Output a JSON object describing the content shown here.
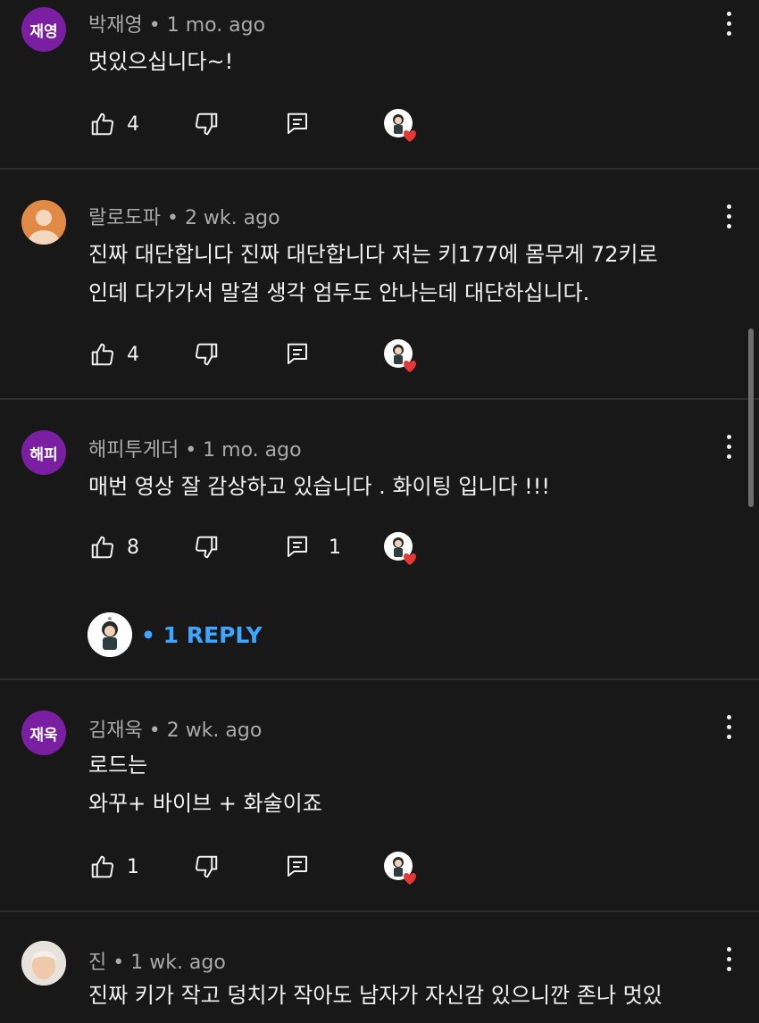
{
  "colors": {
    "background": "#181818",
    "text": "#f1f1f1",
    "meta": "#aaaaaa",
    "link": "#3ea6ff",
    "avatar_purple": "#7b1fa2",
    "heart": "#e53935"
  },
  "comments": [
    {
      "avatar_text": "재영",
      "author": "박재영",
      "time": "1 mo. ago",
      "lines": [
        "멋있으십니다~!"
      ],
      "likes": "4",
      "replies_count": ""
    },
    {
      "avatar_text": "",
      "author": "랄로도파",
      "time": "2 wk. ago",
      "lines": [
        "진짜 대단합니다 진짜 대단합니다 저는 키177에 몸무게 72키로",
        "인데  다가가서 말걸 생각 엄두도 안나는데   대단하십니다."
      ],
      "likes": "4",
      "replies_count": ""
    },
    {
      "avatar_text": "해피",
      "author": "해피투게더",
      "time": "1 mo. ago",
      "lines": [
        "매번 영상 잘 감상하고 있습니다 . 화이팅 입니다 !!!"
      ],
      "likes": "8",
      "replies_count": "1"
    },
    {
      "avatar_text": "재욱",
      "author": "김재욱",
      "time": "2 wk. ago",
      "lines": [
        "로드는",
        "와꾸+ 바이브 + 화술이죠"
      ],
      "likes": "1",
      "replies_count": ""
    },
    {
      "avatar_text": "",
      "author": "진",
      "time": "1 wk. ago",
      "lines": [
        "진짜 키가 작고 덩치가 작아도 남자가 자신감 있으니깐 존나 멋있"
      ],
      "likes": "",
      "replies_count": ""
    }
  ],
  "reply_link": {
    "label": "• 1 REPLY"
  },
  "meta_separator": " • ",
  "icons": {
    "like": "thumb-up-icon",
    "dislike": "thumb-down-icon",
    "reply": "reply-icon",
    "more": "more-vert-icon",
    "creator_heart": "creator-heart-icon"
  }
}
